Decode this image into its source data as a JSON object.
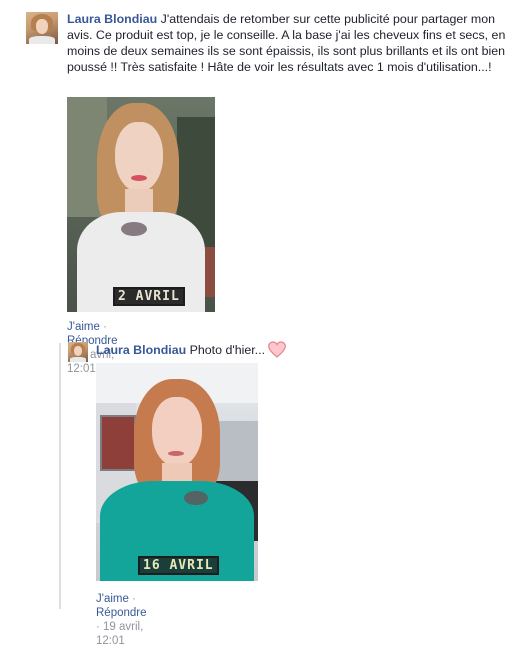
{
  "comment1": {
    "author": "Laura Blondiau",
    "text": " J'attendais de retomber sur cette publicité pour partager mon avis. Ce produit est top, je le conseille. A la base j'ai les cheveux fins et secs, en moins de deux semaines ils se sont épaissis, ils sont plus brillants et ils ont bien poussé !! Très satisfaite ! Hâte de voir les résultats avec 1 mois d'utilisation...!",
    "photo_stamp": "2 AVRIL",
    "actions": {
      "like": "J'aime",
      "reply": "Répondre",
      "time": "19 avril, 12:01"
    }
  },
  "reply1": {
    "author": "Laura Blondiau",
    "text": " Photo d'hier...",
    "emoji_icon": "heart-icon",
    "photo_stamp": "16 AVRIL",
    "actions": {
      "like": "J'aime",
      "reply": "Répondre",
      "time": "19 avril, 12:01"
    }
  },
  "colors": {
    "link": "#385898",
    "meta": "#90949c",
    "heart_fill": "#ffc6cc",
    "heart_stroke": "#e3848f"
  }
}
